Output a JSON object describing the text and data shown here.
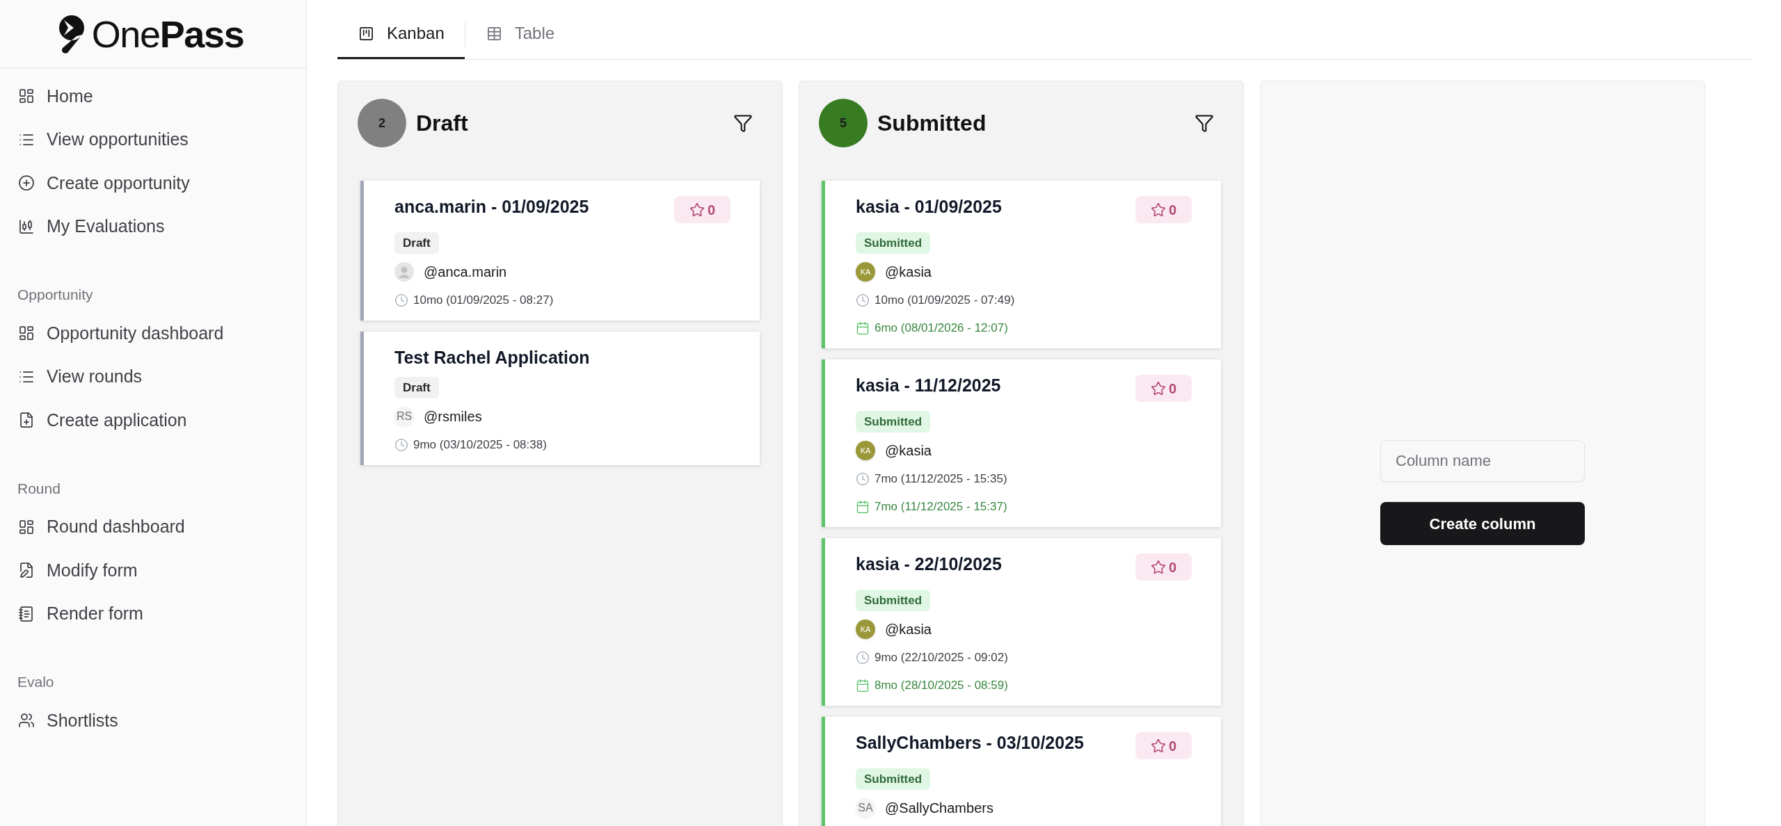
{
  "sidebar": {
    "logo": "One**Pass**",
    "sections": [
      {
        "items": [
          "Home",
          "View opportunities",
          "Create opportunity",
          "My Evaluations"
        ]
      },
      {
        "heading": "Opportunity",
        "items": [
          "Opportunity dashboard",
          "View rounds",
          "Create application"
        ]
      },
      {
        "heading": "Round",
        "items": [
          "Round dashboard",
          "Modify form",
          "Render form"
        ]
      },
      {
        "heading": "Evalo",
        "items": [
          "Shortlists"
        ]
      }
    ]
  },
  "tabs": [
    {
      "label": "Kanban",
      "selected": true
    },
    {
      "label": "Table",
      "selected": false
    }
  ],
  "columns": [
    {
      "kind": "draft",
      "count": "2",
      "title": "Draft",
      "color": "#808080",
      "cards": [
        {
          "title": "anca.marin - 01/09/2025",
          "rating": "0",
          "status": "Draft",
          "avatar": {
            "kind": "placeholder"
          },
          "handle": "@anca.marin",
          "clock_time": "10mo (01/09/2025 - 08:27)"
        },
        {
          "title": "Test Rachel Application",
          "status": "Draft",
          "avatar": {
            "kind": "initials",
            "initials": "RS"
          },
          "handle": "@rsmiles",
          "clock_time": "9mo (03/10/2025 - 08:38)"
        }
      ]
    },
    {
      "kind": "submitted",
      "count": "5",
      "title": "Submitted",
      "color": "#377b22",
      "cards": [
        {
          "title": "kasia - 01/09/2025",
          "rating": "0",
          "status": "Submitted",
          "avatar": {
            "kind": "initials",
            "initials": "KA",
            "color": "#9a9838"
          },
          "handle": "@kasia",
          "clock_time": "10mo (01/09/2025 - 07:49)",
          "calendar_time": "6mo (08/01/2026 - 12:07)"
        },
        {
          "title": "kasia - 11/12/2025",
          "rating": "0",
          "status": "Submitted",
          "avatar": {
            "kind": "initials",
            "initials": "KA",
            "color": "#9a9838"
          },
          "handle": "@kasia",
          "clock_time": "7mo (11/12/2025 - 15:35)",
          "calendar_time": "7mo (11/12/2025 - 15:37)"
        },
        {
          "title": "kasia - 22/10/2025",
          "rating": "0",
          "status": "Submitted",
          "avatar": {
            "kind": "initials",
            "initials": "KA",
            "color": "#9a9838"
          },
          "handle": "@kasia",
          "clock_time": "9mo (22/10/2025 - 09:02)",
          "calendar_time": "8mo (28/10/2025 - 08:59)"
        },
        {
          "title": "SallyChambers - 03/10/2025",
          "rating": "0",
          "status": "Submitted",
          "avatar": {
            "kind": "initials",
            "initials": "SA"
          },
          "handle": "@SallyChambers"
        }
      ]
    }
  ],
  "new_column": {
    "placeholder": "Column name",
    "button": "Create column"
  }
}
